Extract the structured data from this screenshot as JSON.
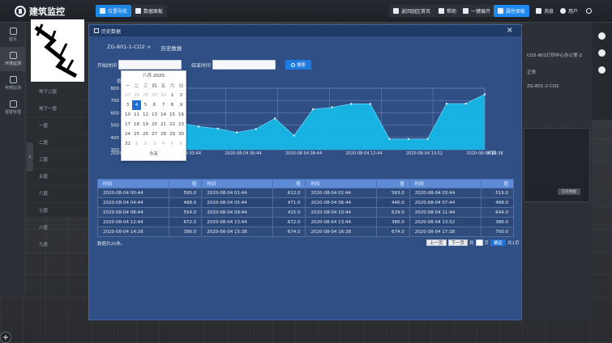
{
  "app": {
    "title": "建筑监控"
  },
  "topnav": {
    "position_label": "位置导航",
    "data_panel_label": "数据面板",
    "back_label": "返回园区首页",
    "help_label": "帮助",
    "expand_label": "一键展开",
    "alarm_panel_label": "属性面板",
    "message_label": "消息",
    "user_label": "用户"
  },
  "sidebar": {
    "items": [
      {
        "label": "首页"
      },
      {
        "label": "环境监测"
      },
      {
        "label": "电梯监测"
      },
      {
        "label": "报警管理"
      }
    ]
  },
  "floors": [
    "地下二层",
    "地下一层",
    "一层",
    "二层",
    "三层",
    "五层",
    "六层",
    "七层",
    "八层",
    "九层"
  ],
  "rightpanel": {
    "title": "CO2-801打印中心办公室-2",
    "status": "正常",
    "device": "ZG-801-2-CO2",
    "button": "历史数据"
  },
  "modal": {
    "title": "历史数据",
    "breadcrumb_device": "ZG-801-1-CO2 >",
    "breadcrumb_page": "历史数据",
    "start_label": "开始时间",
    "end_label": "结束时间",
    "search_label": "搜索"
  },
  "datepicker": {
    "month_label": "八月 2020",
    "weekdays": [
      "一",
      "二",
      "三",
      "四",
      "五",
      "六",
      "日"
    ],
    "today_label": "今天"
  },
  "chart_data": {
    "type": "area",
    "title": "",
    "ylabel": "值",
    "xlabel": "时间",
    "ylim": [
      300,
      800
    ],
    "yticks": [
      300,
      400,
      500,
      600,
      700,
      800
    ],
    "xtick_labels": [
      "2020-08-04 00:44",
      "2020-08-04 03:44",
      "2020-08-04 06:44",
      "2020-08-04 09:44",
      "2020-08-04 12:44",
      "2020-08-04 13:52",
      "2020-08-04 16:38"
    ],
    "values": [
      595.0,
      612.0,
      563.0,
      519.0,
      488.0,
      471.0,
      440.0,
      468.0,
      554.0,
      415.0,
      629.0,
      644.0,
      672.0,
      672.0,
      386.0,
      386.0,
      386.0,
      674.0,
      674.0,
      750.0
    ],
    "color": "#16b7e6"
  },
  "table": {
    "headers": [
      "时间",
      "值",
      "时间",
      "值",
      "时间",
      "值",
      "时间",
      "值"
    ],
    "rows": [
      [
        "2020-08-04 00:44",
        "595.0",
        "2020-08-04 01:44",
        "612.0",
        "2020-08-04 02:44",
        "563.0",
        "2020-08-04 03:44",
        "519.0"
      ],
      [
        "2020-08-04 04:44",
        "488.0",
        "2020-08-04 05:44",
        "471.0",
        "2020-08-04 06:44",
        "440.0",
        "2020-08-04 07:44",
        "468.0"
      ],
      [
        "2020-08-04 08:44",
        "554.0",
        "2020-08-04 09:44",
        "415.0",
        "2020-08-04 10:44",
        "629.0",
        "2020-08-04 11:44",
        "644.0"
      ],
      [
        "2020-08-04 12:44",
        "672.0",
        "2020-08-04 13:44",
        "672.0",
        "2020-08-04 13:44",
        "386.0",
        "2020-08-04 13:52",
        "386.0"
      ],
      [
        "2020-08-04 14:28",
        "386.0",
        "2020-08-04 15:38",
        "674.0",
        "2020-08-04 16:38",
        "674.0",
        "2020-08-04 17:38",
        "750.0"
      ]
    ]
  },
  "footer": {
    "total_text": "数据共20条。",
    "prev_label": "上一页",
    "next_label": "下一页",
    "goto_label": "到",
    "page_label": "页",
    "confirm_label": "确定",
    "pages_label": "共1页"
  }
}
